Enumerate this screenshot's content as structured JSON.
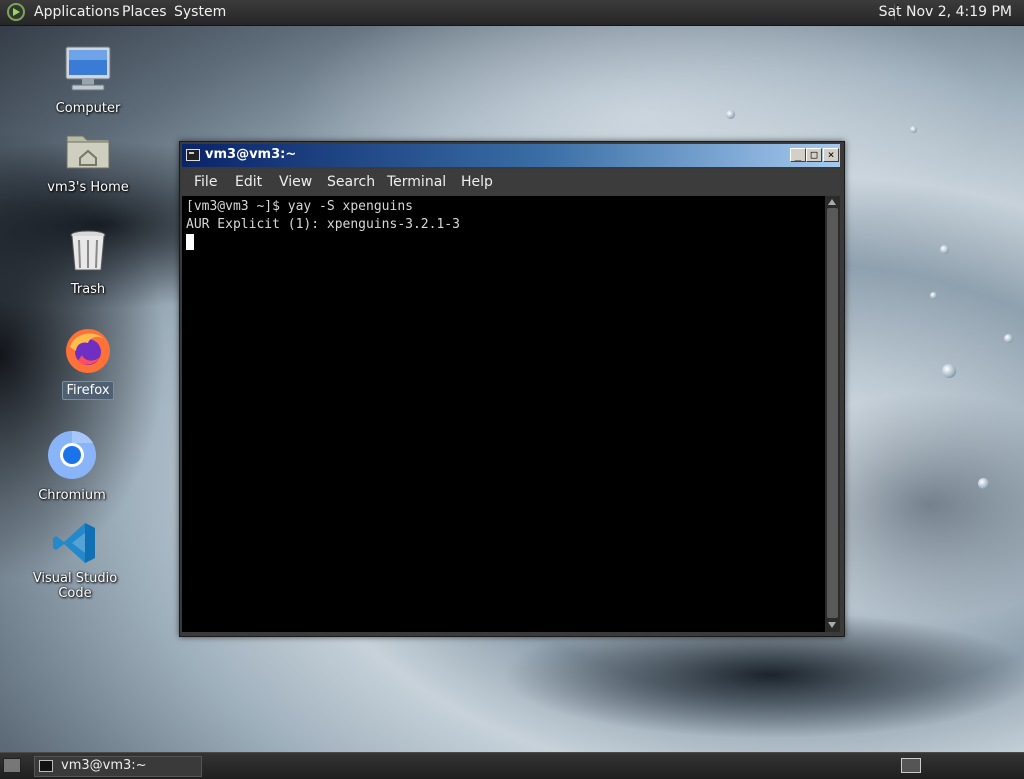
{
  "top_panel": {
    "menus": [
      "Applications",
      "Places",
      "System"
    ],
    "clock": "Sat Nov 2, 4:19 PM"
  },
  "desktop_icons": [
    {
      "label": "Computer",
      "icon": "computer-icon"
    },
    {
      "label": "vm3's Home",
      "icon": "home-folder-icon"
    },
    {
      "label": "Trash",
      "icon": "trash-icon"
    },
    {
      "label": "Firefox",
      "icon": "firefox-icon"
    },
    {
      "label": "Chromium",
      "icon": "chromium-icon"
    },
    {
      "label": "Visual Studio Code",
      "icon": "vscode-icon"
    }
  ],
  "terminal": {
    "title": "vm3@vm3:~",
    "menu": [
      "File",
      "Edit",
      "View",
      "Search",
      "Terminal",
      "Help"
    ],
    "lines": [
      "[vm3@vm3 ~]$ yay -S xpenguins",
      "AUR Explicit (1): xpenguins-3.2.1-3"
    ],
    "buttons": {
      "minimize": "_",
      "maximize": "□",
      "close": "×"
    }
  },
  "taskbar": {
    "window_label": "vm3@vm3:~"
  }
}
